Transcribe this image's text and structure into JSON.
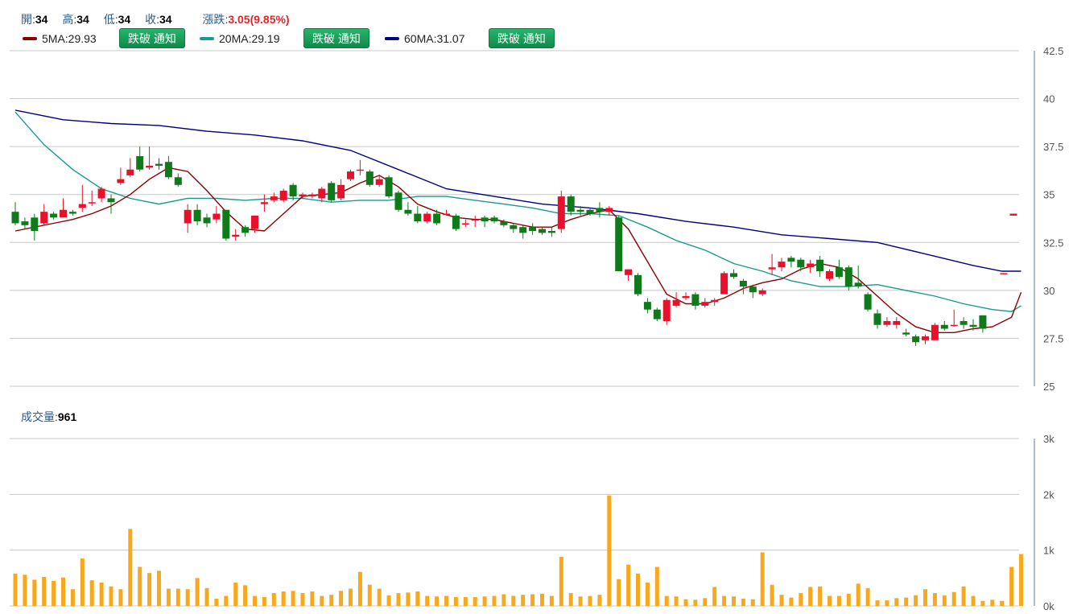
{
  "quote": {
    "open_label": "開",
    "open": "34",
    "high_label": "高",
    "high": "34",
    "low_label": "低",
    "low": "34",
    "close_label": "收",
    "close": "34",
    "change_label": "漲跌",
    "change": "3.05(9.85%)"
  },
  "ma_legend": [
    {
      "label": "5MA:29.93",
      "color": "#8b0000",
      "button": "跌破 通知"
    },
    {
      "label": "20MA:29.19",
      "color": "#1a9a8e",
      "button": "跌破 通知"
    },
    {
      "label": "60MA:31.07",
      "color": "#000080",
      "button": "跌破 通知"
    }
  ],
  "volume": {
    "label": "成交量",
    "value": "961"
  },
  "colors": {
    "up": "#e8102a",
    "down": "#0e7a19",
    "volume": "#f7a81c",
    "grid": "#c8c8c8"
  },
  "chart_data": [
    {
      "type": "candlestick",
      "ylim": [
        25,
        42.5
      ],
      "yticks": [
        "42.5",
        "40",
        "37.5",
        "35",
        "32.5",
        "30",
        "27.5",
        "25"
      ],
      "ytick_values": [
        42.5,
        40,
        37.5,
        35,
        32.5,
        30,
        27.5,
        25
      ],
      "candles": [
        [
          34.1,
          33.5,
          34.6,
          33.4
        ],
        [
          33.6,
          33.4,
          33.8,
          33.2
        ],
        [
          33.8,
          33.1,
          34.0,
          32.6
        ],
        [
          33.5,
          34.1,
          34.5,
          33.4
        ],
        [
          34.0,
          33.8,
          34.1,
          33.7
        ],
        [
          33.8,
          34.2,
          34.8,
          33.8
        ],
        [
          34.1,
          34.0,
          34.2,
          33.9
        ],
        [
          34.3,
          34.5,
          35.5,
          34.1
        ],
        [
          34.6,
          34.6,
          35.2,
          34.4
        ],
        [
          34.8,
          35.3,
          35.4,
          34.6
        ],
        [
          34.8,
          34.6,
          35.0,
          34.0
        ],
        [
          35.6,
          35.8,
          36.4,
          35.5
        ],
        [
          36.0,
          36.3,
          36.9,
          35.9
        ],
        [
          37.0,
          36.3,
          37.5,
          36.2
        ],
        [
          36.4,
          36.5,
          37.5,
          36.3
        ],
        [
          36.6,
          36.5,
          36.9,
          36.3
        ],
        [
          36.7,
          35.9,
          37.0,
          35.8
        ],
        [
          35.9,
          35.5,
          36.1,
          35.4
        ],
        [
          33.5,
          34.2,
          34.5,
          33.0
        ],
        [
          34.2,
          33.6,
          34.5,
          33.4
        ],
        [
          33.8,
          33.5,
          34.0,
          33.3
        ],
        [
          33.7,
          34.0,
          34.4,
          33.5
        ],
        [
          34.2,
          32.7,
          34.2,
          32.6
        ],
        [
          32.8,
          32.9,
          33.2,
          32.6
        ],
        [
          33.3,
          33.0,
          33.4,
          32.8
        ],
        [
          33.2,
          33.9,
          33.9,
          33.0
        ],
        [
          34.5,
          34.6,
          35.0,
          34.1
        ],
        [
          34.7,
          34.9,
          35.1,
          34.6
        ],
        [
          34.7,
          35.2,
          35.3,
          34.6
        ],
        [
          35.5,
          34.9,
          35.6,
          34.7
        ],
        [
          34.9,
          35.0,
          35.1,
          34.8
        ],
        [
          34.9,
          35.0,
          35.1,
          34.8
        ],
        [
          34.8,
          35.3,
          35.4,
          34.6
        ],
        [
          35.6,
          34.7,
          35.7,
          34.6
        ],
        [
          34.8,
          35.5,
          35.8,
          34.7
        ],
        [
          35.8,
          36.2,
          36.3,
          35.7
        ],
        [
          36.3,
          36.3,
          36.8,
          36.0
        ],
        [
          36.2,
          35.5,
          36.3,
          35.4
        ],
        [
          35.5,
          35.8,
          36.0,
          35.4
        ],
        [
          35.9,
          34.9,
          36.0,
          34.8
        ],
        [
          35.1,
          34.2,
          35.2,
          34.1
        ],
        [
          34.2,
          34.0,
          34.6,
          33.9
        ],
        [
          34.0,
          33.6,
          34.4,
          33.5
        ],
        [
          33.6,
          34.0,
          34.1,
          33.5
        ],
        [
          34.0,
          33.5,
          34.2,
          33.4
        ],
        [
          34.0,
          34.0,
          34.2,
          33.9
        ],
        [
          33.9,
          33.2,
          34.0,
          33.1
        ],
        [
          33.5,
          33.5,
          33.7,
          33.3
        ],
        [
          33.7,
          33.7,
          33.9,
          33.3
        ],
        [
          33.8,
          33.6,
          33.9,
          33.3
        ],
        [
          33.8,
          33.6,
          33.9,
          33.5
        ],
        [
          33.6,
          33.4,
          33.7,
          33.3
        ],
        [
          33.4,
          33.2,
          33.5,
          33.0
        ],
        [
          33.3,
          33.0,
          33.4,
          32.7
        ],
        [
          33.3,
          33.1,
          33.5,
          32.9
        ],
        [
          33.2,
          33.0,
          33.3,
          32.9
        ],
        [
          33.1,
          33.0,
          33.3,
          32.8
        ],
        [
          33.2,
          34.9,
          35.2,
          33.0
        ],
        [
          34.9,
          34.1,
          35.0,
          33.9
        ],
        [
          34.2,
          34.1,
          34.4,
          33.9
        ],
        [
          34.2,
          34.0,
          34.3,
          33.9
        ],
        [
          34.3,
          34.1,
          34.6,
          33.8
        ],
        [
          34.1,
          34.3,
          34.4,
          33.9
        ],
        [
          33.8,
          31.0,
          33.9,
          31.0
        ],
        [
          30.8,
          31.1,
          31.1,
          30.5
        ],
        [
          30.8,
          29.8,
          30.9,
          29.7
        ],
        [
          29.4,
          29.0,
          29.6,
          28.8
        ],
        [
          29.0,
          28.5,
          29.1,
          28.4
        ],
        [
          28.4,
          29.5,
          29.6,
          28.2
        ],
        [
          29.2,
          29.5,
          29.9,
          29.1
        ],
        [
          29.6,
          29.7,
          29.9,
          29.5
        ],
        [
          29.8,
          29.2,
          29.9,
          29.0
        ],
        [
          29.2,
          29.4,
          29.6,
          29.1
        ],
        [
          29.4,
          29.5,
          29.6,
          29.2
        ],
        [
          29.8,
          30.9,
          31.0,
          29.8
        ],
        [
          30.9,
          30.7,
          31.1,
          30.6
        ],
        [
          30.5,
          30.2,
          30.6,
          29.8
        ],
        [
          30.2,
          29.9,
          30.3,
          29.6
        ],
        [
          29.8,
          30.0,
          30.1,
          29.7
        ],
        [
          31.1,
          31.2,
          31.9,
          30.8
        ],
        [
          31.2,
          31.5,
          31.7,
          31.0
        ],
        [
          31.7,
          31.5,
          31.8,
          31.2
        ],
        [
          31.6,
          31.2,
          31.7,
          31.0
        ],
        [
          31.2,
          31.4,
          31.6,
          30.9
        ],
        [
          31.6,
          31.0,
          31.8,
          30.7
        ],
        [
          30.6,
          31.0,
          31.1,
          30.5
        ],
        [
          31.2,
          30.7,
          31.6,
          30.6
        ],
        [
          31.2,
          30.2,
          31.3,
          30.0
        ],
        [
          30.4,
          30.2,
          31.3,
          30.1
        ],
        [
          29.8,
          29.0,
          29.9,
          28.9
        ],
        [
          28.8,
          28.2,
          29.0,
          28.0
        ],
        [
          28.2,
          28.4,
          28.6,
          28.1
        ],
        [
          28.2,
          28.4,
          28.6,
          28.0
        ],
        [
          27.8,
          27.7,
          28.0,
          27.6
        ],
        [
          27.6,
          27.3,
          27.7,
          27.1
        ],
        [
          27.4,
          27.6,
          27.7,
          27.2
        ],
        [
          27.4,
          28.2,
          28.3,
          27.4
        ],
        [
          28.2,
          28.0,
          28.4,
          27.9
        ],
        [
          28.2,
          28.2,
          29.0,
          28.1
        ],
        [
          28.4,
          28.2,
          28.6,
          28.0
        ],
        [
          28.2,
          28.1,
          28.5,
          27.9
        ],
        [
          28.7,
          28.0,
          28.7,
          27.8
        ],
        [
          33.9,
          34.0,
          34.0,
          33.9
        ],
        [
          30.9,
          30.9,
          30.9,
          30.9
        ]
      ],
      "ma5": [
        [
          0,
          33.1
        ],
        [
          2,
          33.3
        ],
        [
          4,
          33.5
        ],
        [
          6,
          33.7
        ],
        [
          8,
          34.0
        ],
        [
          10,
          34.4
        ],
        [
          12,
          35.0
        ],
        [
          14,
          35.8
        ],
        [
          16,
          36.4
        ],
        [
          18,
          36.2
        ],
        [
          20,
          35.2
        ],
        [
          22,
          34.1
        ],
        [
          24,
          33.2
        ],
        [
          26,
          33.1
        ],
        [
          28,
          34.0
        ],
        [
          30,
          34.9
        ],
        [
          32,
          35.0
        ],
        [
          34,
          35.1
        ],
        [
          36,
          35.6
        ],
        [
          38,
          36.0
        ],
        [
          40,
          35.4
        ],
        [
          42,
          34.5
        ],
        [
          44,
          34.1
        ],
        [
          46,
          33.8
        ],
        [
          48,
          33.7
        ],
        [
          50,
          33.7
        ],
        [
          52,
          33.5
        ],
        [
          54,
          33.3
        ],
        [
          56,
          33.3
        ],
        [
          58,
          33.7
        ],
        [
          60,
          34.0
        ],
        [
          62,
          34.2
        ],
        [
          64,
          33.2
        ],
        [
          66,
          31.5
        ],
        [
          68,
          29.8
        ],
        [
          70,
          29.3
        ],
        [
          72,
          29.3
        ],
        [
          74,
          29.6
        ],
        [
          76,
          30.1
        ],
        [
          78,
          30.4
        ],
        [
          80,
          30.6
        ],
        [
          82,
          31.1
        ],
        [
          84,
          31.4
        ],
        [
          86,
          31.2
        ],
        [
          88,
          30.6
        ],
        [
          90,
          29.7
        ],
        [
          92,
          28.8
        ],
        [
          94,
          28.1
        ],
        [
          96,
          27.8
        ],
        [
          98,
          27.8
        ],
        [
          100,
          28.0
        ],
        [
          102,
          28.1
        ],
        [
          104,
          28.6
        ],
        [
          105,
          29.9
        ]
      ],
      "ma20": [
        [
          0,
          39.3
        ],
        [
          3,
          37.6
        ],
        [
          6,
          36.3
        ],
        [
          9,
          35.3
        ],
        [
          12,
          34.8
        ],
        [
          15,
          34.5
        ],
        [
          18,
          34.8
        ],
        [
          21,
          34.8
        ],
        [
          24,
          34.7
        ],
        [
          27,
          34.8
        ],
        [
          30,
          34.8
        ],
        [
          33,
          34.6
        ],
        [
          36,
          34.7
        ],
        [
          39,
          34.7
        ],
        [
          42,
          34.9
        ],
        [
          45,
          34.9
        ],
        [
          48,
          34.7
        ],
        [
          51,
          34.5
        ],
        [
          54,
          34.3
        ],
        [
          57,
          34.0
        ],
        [
          60,
          34.0
        ],
        [
          63,
          33.9
        ],
        [
          66,
          33.3
        ],
        [
          69,
          32.6
        ],
        [
          72,
          32.1
        ],
        [
          75,
          31.4
        ],
        [
          78,
          31.0
        ],
        [
          81,
          30.5
        ],
        [
          84,
          30.2
        ],
        [
          87,
          30.2
        ],
        [
          90,
          30.3
        ],
        [
          93,
          30.0
        ],
        [
          96,
          29.7
        ],
        [
          99,
          29.3
        ],
        [
          102,
          29.0
        ],
        [
          104,
          28.9
        ],
        [
          105,
          29.2
        ]
      ],
      "ma60": [
        [
          0,
          39.4
        ],
        [
          5,
          38.9
        ],
        [
          10,
          38.7
        ],
        [
          15,
          38.6
        ],
        [
          20,
          38.3
        ],
        [
          25,
          38.1
        ],
        [
          30,
          37.8
        ],
        [
          35,
          37.3
        ],
        [
          40,
          36.3
        ],
        [
          45,
          35.3
        ],
        [
          50,
          34.9
        ],
        [
          55,
          34.5
        ],
        [
          60,
          34.3
        ],
        [
          65,
          34.0
        ],
        [
          70,
          33.6
        ],
        [
          75,
          33.3
        ],
        [
          80,
          32.9
        ],
        [
          85,
          32.7
        ],
        [
          90,
          32.5
        ],
        [
          95,
          31.9
        ],
        [
          100,
          31.3
        ],
        [
          103,
          31.0
        ],
        [
          105,
          31.0
        ]
      ]
    },
    {
      "type": "bar",
      "ylim": [
        0,
        3000
      ],
      "yticks": [
        "3k",
        "2k",
        "1k",
        "0k"
      ],
      "ytick_values": [
        3000,
        2000,
        1000,
        0
      ],
      "values": [
        580,
        560,
        470,
        520,
        450,
        510,
        300,
        850,
        460,
        420,
        350,
        300,
        1380,
        700,
        590,
        630,
        310,
        310,
        300,
        500,
        320,
        130,
        180,
        420,
        370,
        180,
        160,
        230,
        260,
        270,
        230,
        260,
        180,
        200,
        270,
        310,
        610,
        380,
        310,
        190,
        230,
        240,
        260,
        180,
        170,
        180,
        160,
        160,
        160,
        170,
        180,
        210,
        180,
        200,
        210,
        220,
        180,
        880,
        230,
        170,
        180,
        200,
        1980,
        480,
        740,
        580,
        420,
        700,
        180,
        170,
        120,
        110,
        140,
        340,
        180,
        170,
        130,
        120,
        960,
        380,
        200,
        150,
        230,
        340,
        350,
        180,
        180,
        220,
        400,
        320,
        100,
        100,
        140,
        150,
        190,
        300,
        230,
        190,
        250,
        350,
        180,
        90,
        110,
        90,
        700,
        930
      ]
    }
  ]
}
